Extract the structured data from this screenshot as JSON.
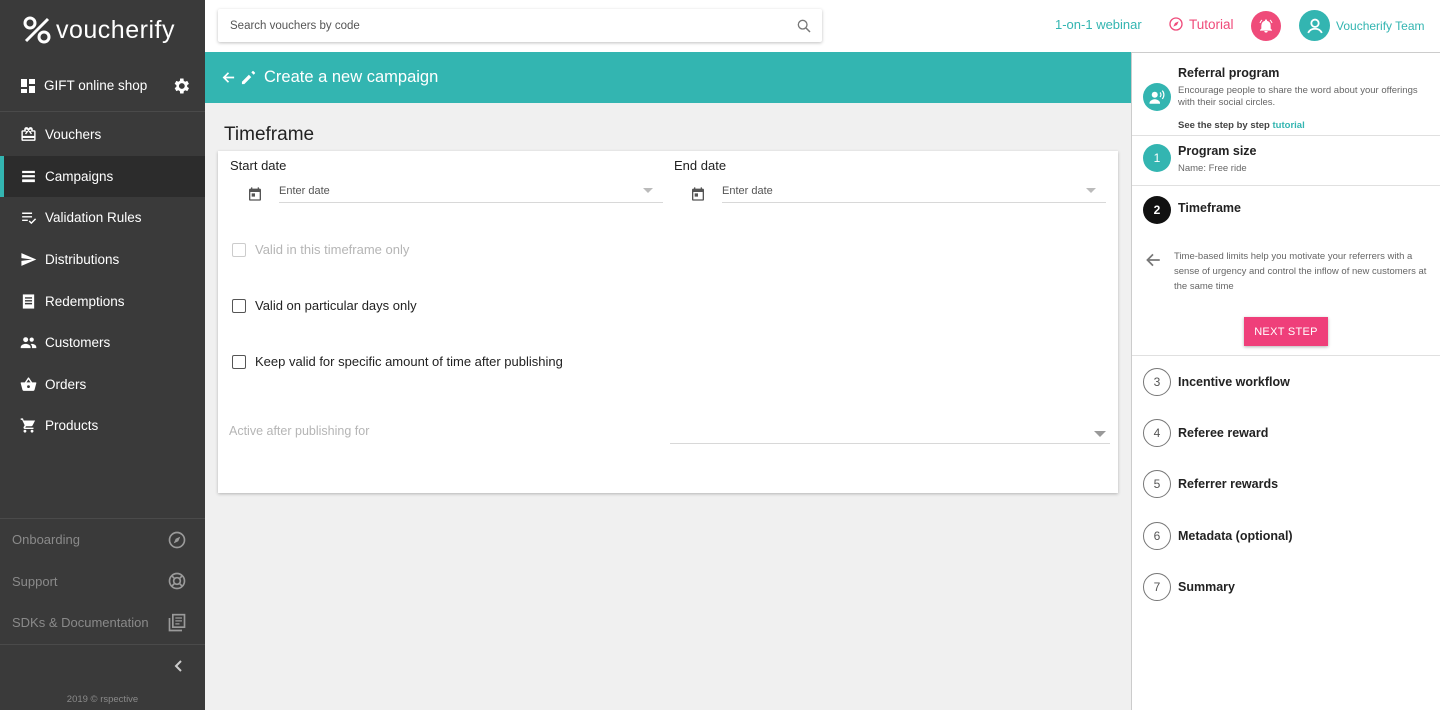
{
  "app": {
    "logo_text": "voucherify"
  },
  "sidebar": {
    "shop_label": "GIFT online shop",
    "items": [
      {
        "label": "Vouchers",
        "icon": "gift-box-icon"
      },
      {
        "label": "Campaigns",
        "icon": "list-icon",
        "active": true
      },
      {
        "label": "Validation Rules",
        "icon": "rules-list-icon"
      },
      {
        "label": "Distributions",
        "icon": "send-icon"
      },
      {
        "label": "Redemptions",
        "icon": "receipt-icon"
      },
      {
        "label": "Customers",
        "icon": "people-icon"
      },
      {
        "label": "Orders",
        "icon": "basket-icon"
      },
      {
        "label": "Products",
        "icon": "cart-icon"
      }
    ],
    "bottom_links": [
      {
        "label": "Onboarding",
        "icon": "compass-icon"
      },
      {
        "label": "Support",
        "icon": "lifebuoy-icon"
      },
      {
        "label": "SDKs & Documentation",
        "icon": "docs-icon"
      }
    ],
    "copyright": "2019 © rspective"
  },
  "topbar": {
    "search_placeholder": "Search vouchers by code",
    "webinar_label": "1-on-1 webinar",
    "tutorial_label": "Tutorial",
    "user_name": "Voucherify Team"
  },
  "header": {
    "title": "Create a new campaign"
  },
  "main": {
    "section_title": "Timeframe",
    "start_date": {
      "label": "Start date",
      "placeholder": "Enter date"
    },
    "end_date": {
      "label": "End date",
      "placeholder": "Enter date"
    },
    "checkboxes": [
      {
        "label": "Valid in this timeframe only",
        "disabled": true,
        "checked": false
      },
      {
        "label": "Valid on particular days only",
        "disabled": false,
        "checked": false
      },
      {
        "label": "Keep valid for specific amount of time after publishing",
        "disabled": false,
        "checked": false
      }
    ],
    "active_after_label": "Active after publishing for"
  },
  "right_panel": {
    "program": {
      "title": "Referral program",
      "description": "Encourage people to share the word about your offerings with their social circles.",
      "see_steps": "See the step by step",
      "tutorial_link": "tutorial"
    },
    "steps": [
      {
        "number": "1",
        "title": "Program size",
        "subtitle": "Name: Free ride",
        "status": "done"
      },
      {
        "number": "2",
        "title": "Timeframe",
        "status": "current"
      },
      {
        "number": "3",
        "title": "Incentive workflow",
        "status": "todo"
      },
      {
        "number": "4",
        "title": "Referee reward",
        "status": "todo"
      },
      {
        "number": "5",
        "title": "Referrer rewards",
        "status": "todo"
      },
      {
        "number": "6",
        "title": "Metadata (optional)",
        "status": "todo"
      },
      {
        "number": "7",
        "title": "Summary",
        "status": "todo"
      }
    ],
    "current_description": "Time-based limits help you motivate your referrers with a sense of urgency and control the inflow of new customers at the same time",
    "next_button": "NEXT STEP"
  },
  "colors": {
    "accent": "#33b5b1",
    "pink": "#ef3f7a",
    "sidebar_bg": "#3a3a3a"
  }
}
